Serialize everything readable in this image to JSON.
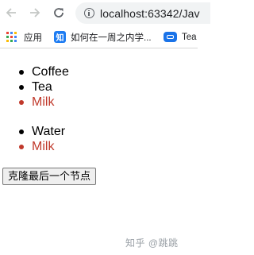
{
  "browser": {
    "url": "localhost:63342/Jav",
    "icons": {
      "back": "arrow-left-icon",
      "forward": "arrow-right-icon",
      "reload": "reload-icon",
      "site_info": "info-icon"
    }
  },
  "bookmarks": [
    {
      "label": "应用",
      "icon": "apps-grid-icon"
    },
    {
      "label": "如何在一周之内学...",
      "icon": "zhihu-icon"
    },
    {
      "label": "Tea",
      "icon": "tea-icon"
    }
  ],
  "zhihu_badge": "知",
  "page": {
    "list1": [
      "Coffee",
      "Tea",
      "Milk"
    ],
    "list2": [
      "Water",
      "Milk"
    ],
    "clone_button": "克隆最后一个节点"
  },
  "watermark": "知乎 @跳跳",
  "colors": {
    "milk": "#c0392b"
  }
}
